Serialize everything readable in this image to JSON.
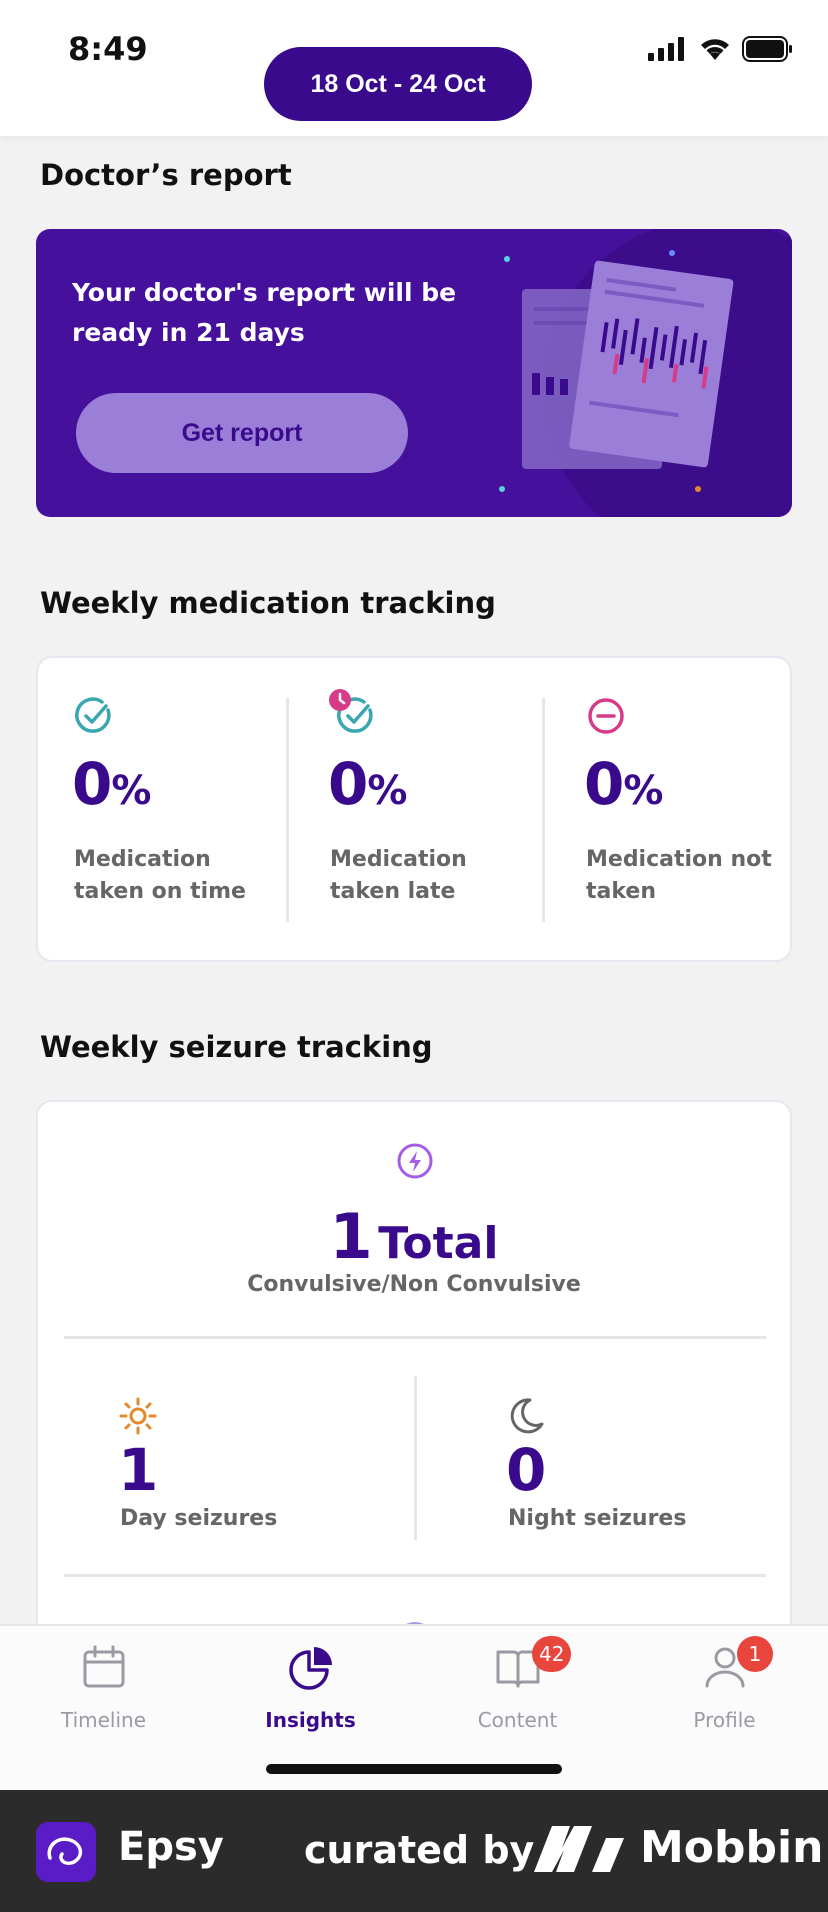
{
  "status_bar": {
    "time": "8:49"
  },
  "header": {
    "date_range": "18 Oct - 24 Oct"
  },
  "doctor_report": {
    "section_title": "Doctor’s report",
    "message": "Your doctor's report will be ready in 21 days",
    "button_label": "Get report"
  },
  "medication": {
    "section_title": "Weekly medication tracking",
    "items": [
      {
        "value": "0",
        "unit": "%",
        "label": "Medication taken on time",
        "icon": "check-circle-icon"
      },
      {
        "value": "0",
        "unit": "%",
        "label": "Medication taken late",
        "icon": "check-clock-icon"
      },
      {
        "value": "0",
        "unit": "%",
        "label": "Medication not taken",
        "icon": "minus-circle-icon"
      }
    ]
  },
  "seizures": {
    "section_title": "Weekly seizure tracking",
    "total_value": "1",
    "total_label": "Total",
    "subtitle": "Convulsive/Non Convulsive",
    "day": {
      "value": "1",
      "label": "Day seizures"
    },
    "night": {
      "value": "0",
      "label": "Night seizures"
    }
  },
  "tabs": [
    {
      "label": "Timeline",
      "icon": "calendar-icon",
      "active": false
    },
    {
      "label": "Insights",
      "icon": "pie-chart-icon",
      "active": true
    },
    {
      "label": "Content",
      "icon": "book-icon",
      "active": false,
      "badge": "42"
    },
    {
      "label": "Profile",
      "icon": "person-icon",
      "active": false,
      "badge": "1"
    }
  ],
  "footer": {
    "app_name": "Epsy",
    "curated_by": "curated by",
    "brand": "Mobbin"
  },
  "colors": {
    "primary": "#3a0a8c",
    "card_bg": "#45109c",
    "badge": "#e8453c",
    "teal": "#3aa6b0",
    "pink": "#d63b87",
    "orange": "#e08a2a"
  }
}
